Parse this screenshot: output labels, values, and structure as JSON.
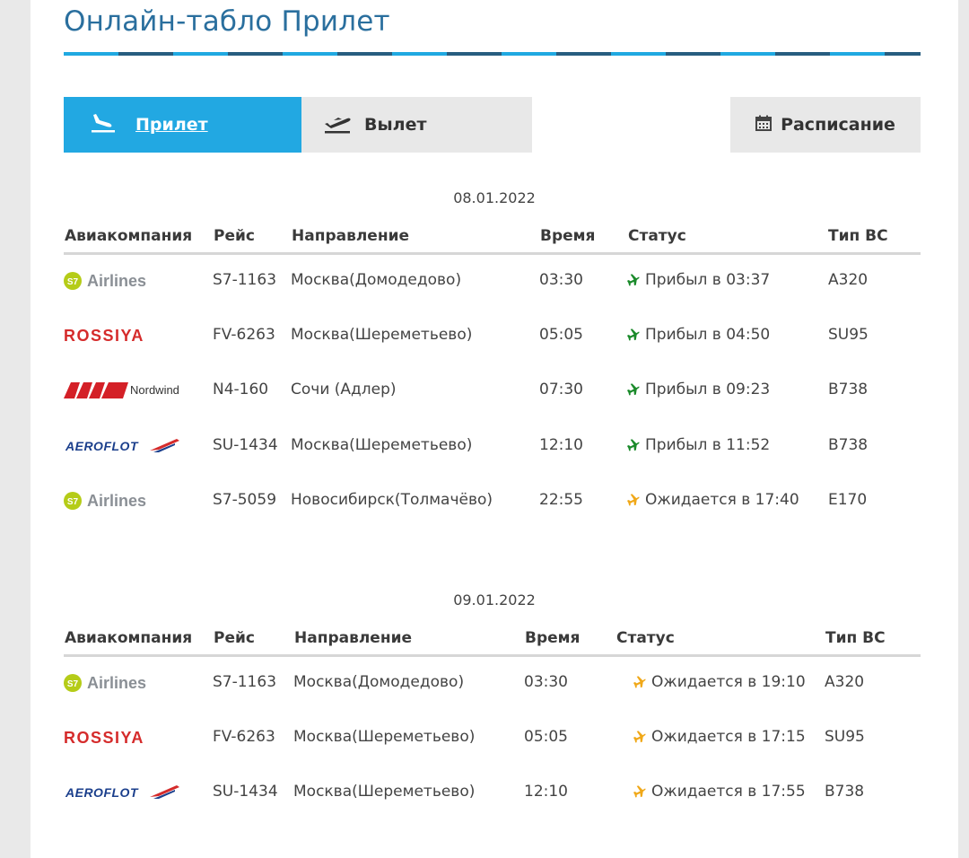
{
  "page": {
    "title": "Онлайн-табло Прилет"
  },
  "tabs": {
    "arrival": "Прилет",
    "departure": "Вылет",
    "schedule": "Расписание"
  },
  "colors": {
    "accent": "#22a8e2",
    "arrived": "#1a8a2a",
    "expected": "#f0a818"
  },
  "headers": {
    "airline": "Авиакомпания",
    "flight": "Рейс",
    "direction": "Направление",
    "time": "Время",
    "status": "Статус",
    "aircraft": "Тип ВС"
  },
  "days": [
    {
      "date": "08.01.2022",
      "rows": [
        {
          "airline": "S7 Airlines",
          "logo_text": "Airlines",
          "logo_badge": "S7",
          "flight": "S7-1163",
          "direction": "Москва(Домодедово)",
          "time": "03:30",
          "status": "Прибыл в 03:37",
          "status_type": "arrived",
          "aircraft": "A320"
        },
        {
          "airline": "Rossiya",
          "logo_text": "ROSSIYA",
          "flight": "FV-6263",
          "direction": "Москва(Шереметьево)",
          "time": "05:05",
          "status": "Прибыл в 04:50",
          "status_type": "arrived",
          "aircraft": "SU95"
        },
        {
          "airline": "Nordwind",
          "logo_text": "Nordwind",
          "flight": "N4-160",
          "direction": "Сочи (Адлер)",
          "time": "07:30",
          "status": "Прибыл в 09:23",
          "status_type": "arrived",
          "aircraft": "B738"
        },
        {
          "airline": "Aeroflot",
          "logo_text": "AEROFLOT",
          "flight": "SU-1434",
          "direction": "Москва(Шереметьево)",
          "time": "12:10",
          "status": "Прибыл в 11:52",
          "status_type": "arrived",
          "aircraft": "B738"
        },
        {
          "airline": "S7 Airlines",
          "logo_text": "Airlines",
          "logo_badge": "S7",
          "flight": "S7-5059",
          "direction": "Новосибирск(Толмачёво)",
          "time": "22:55",
          "status": "Ожидается в 17:40",
          "status_type": "expected",
          "aircraft": "E170"
        }
      ]
    },
    {
      "date": "09.01.2022",
      "rows": [
        {
          "airline": "S7 Airlines",
          "logo_text": "Airlines",
          "logo_badge": "S7",
          "flight": "S7-1163",
          "direction": "Москва(Домодедово)",
          "time": "03:30",
          "status": "Ожидается в 19:10",
          "status_type": "expected",
          "aircraft": "A320"
        },
        {
          "airline": "Rossiya",
          "logo_text": "ROSSIYA",
          "flight": "FV-6263",
          "direction": "Москва(Шереметьево)",
          "time": "05:05",
          "status": "Ожидается в 17:15",
          "status_type": "expected",
          "aircraft": "SU95"
        },
        {
          "airline": "Aeroflot",
          "logo_text": "AEROFLOT",
          "flight": "SU-1434",
          "direction": "Москва(Шереметьево)",
          "time": "12:10",
          "status": "Ожидается в 17:55",
          "status_type": "expected",
          "aircraft": "B738"
        }
      ]
    }
  ]
}
